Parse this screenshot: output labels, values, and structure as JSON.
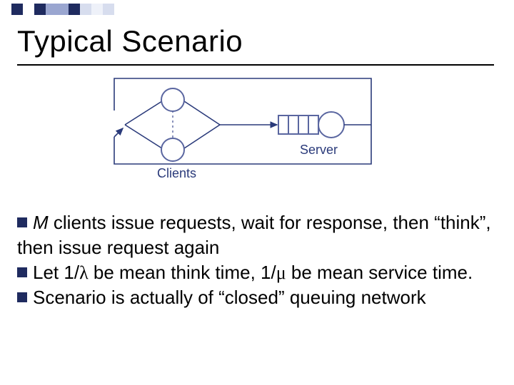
{
  "title": "Typical Scenario",
  "diagram": {
    "server_label": "Server",
    "clients_label": "Clients"
  },
  "bullets": [
    {
      "prefix_italic": "M",
      "text_a": " clients issue requests, wait for response, then “think”, then issue request again"
    },
    {
      "text_a": "Let 1/",
      "sym_a": "λ",
      "text_b": " be mean think time, 1/",
      "sym_b": "μ",
      "text_c": " be mean service time."
    },
    {
      "text_a": "Scenario is actually of “closed” queuing network"
    }
  ],
  "colors": {
    "accent": "#1f2b5f",
    "node_stroke": "#5a66a0",
    "server_label_color": "#2a3a7a"
  }
}
